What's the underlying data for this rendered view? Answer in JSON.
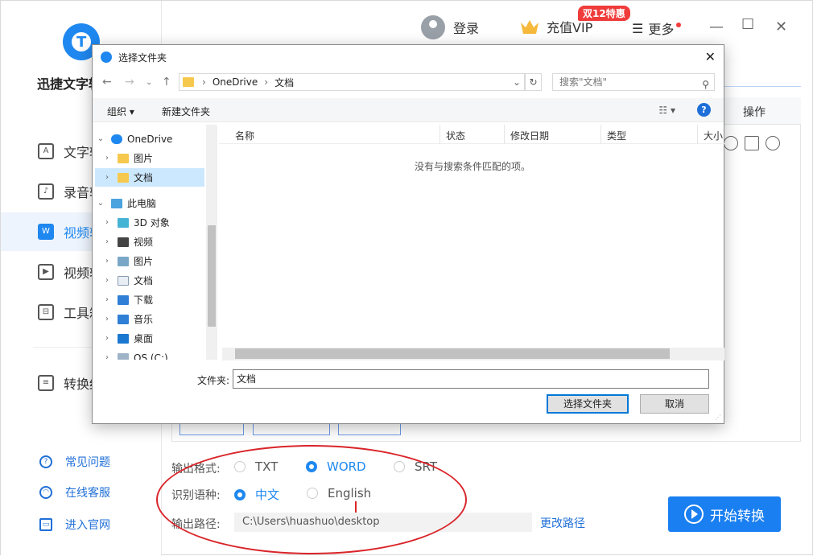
{
  "app": {
    "name": "迅捷文字转",
    "logo_letter": "T"
  },
  "topbar": {
    "login": "登录",
    "vip": "充值VIP",
    "vip_badge": "双12特惠",
    "more": "更多",
    "minimize": "—",
    "maximize": "☐",
    "close": "✕"
  },
  "sidebar": {
    "items": [
      {
        "label": "文字转",
        "icon": "text-doc-icon"
      },
      {
        "label": "录音转",
        "icon": "audio-icon"
      },
      {
        "label": "视频转",
        "icon": "video-icon"
      },
      {
        "label": "视频转",
        "icon": "video2-icon"
      },
      {
        "label": "工具箱",
        "icon": "toolbox-icon"
      },
      {
        "label": "转换结",
        "icon": "result-icon"
      }
    ],
    "footer": [
      {
        "label": "常见问题",
        "icon": "question-icon"
      },
      {
        "label": "在线客服",
        "icon": "headset-icon"
      },
      {
        "label": "进入官网",
        "icon": "monitor-icon"
      }
    ]
  },
  "main": {
    "operation_header": "操作"
  },
  "options": {
    "format_label": "输出格式:",
    "formats": [
      "TXT",
      "WORD",
      "SRT"
    ],
    "selected_format": "WORD",
    "lang_label": "识别语种:",
    "langs": [
      "中文",
      "English"
    ],
    "selected_lang": "中文",
    "path_label": "输出路径:",
    "path_value": "C:\\Users\\huashuo\\desktop",
    "change_path": "更改路径",
    "start": "开始转换"
  },
  "dialog": {
    "title": "选择文件夹",
    "close": "✕",
    "breadcrumb": [
      "OneDrive",
      "文档"
    ],
    "search_placeholder": "搜索\"文档\"",
    "organize": "组织 ▾",
    "new_folder": "新建文件夹",
    "tree": [
      {
        "label": "OneDrive",
        "level": 0,
        "expanded": true,
        "icon": "cloud-icon"
      },
      {
        "label": "图片",
        "level": 1,
        "icon": "folder-icon"
      },
      {
        "label": "文档",
        "level": 1,
        "icon": "folder-icon",
        "selected": true
      },
      {
        "label": "此电脑",
        "level": 0,
        "expanded": true,
        "icon": "computer-icon"
      },
      {
        "label": "3D 对象",
        "level": 1,
        "icon": "cube-icon"
      },
      {
        "label": "视频",
        "level": 1,
        "icon": "film-icon"
      },
      {
        "label": "图片",
        "level": 1,
        "icon": "picture-icon"
      },
      {
        "label": "文档",
        "level": 1,
        "icon": "document-icon"
      },
      {
        "label": "下载",
        "level": 1,
        "icon": "download-icon"
      },
      {
        "label": "音乐",
        "level": 1,
        "icon": "music-icon"
      },
      {
        "label": "桌面",
        "level": 1,
        "icon": "desktop-icon"
      },
      {
        "label": "OS (C:)",
        "level": 1,
        "icon": "drive-icon"
      }
    ],
    "columns": [
      "名称",
      "状态",
      "修改日期",
      "类型",
      "大小"
    ],
    "empty_message": "没有与搜索条件匹配的项。",
    "folder_label": "文件夹:",
    "folder_value": "文档",
    "select_button": "选择文件夹",
    "cancel_button": "取消"
  },
  "colors": {
    "accent": "#1f88f0",
    "annotation": "#d9252a",
    "badge": "#f03b3b"
  }
}
